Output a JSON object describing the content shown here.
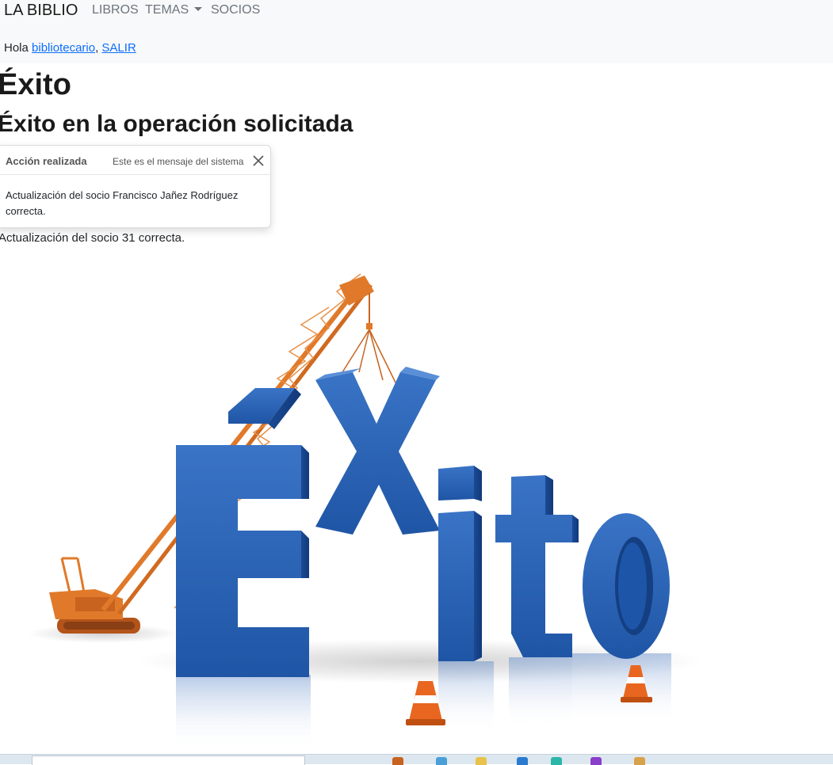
{
  "navbar": {
    "brand": "LA BIBLIO",
    "items": [
      {
        "label": "LIBROS"
      },
      {
        "label": "TEMAS"
      },
      {
        "label": "SOCIOS"
      }
    ]
  },
  "user_bar": {
    "greeting": "Hola ",
    "username": "bibliotecario",
    "separator": ", ",
    "logout": "SALIR"
  },
  "page": {
    "title": "Éxito",
    "subtitle": "Éxito en la operación solicitada",
    "message": "Actualización del socio 31 correcta."
  },
  "toast": {
    "title": "Acción realizada",
    "subtitle": "Este es el mensaje del sistema",
    "body": "Actualización del socio Francisco Jañez Rodríguez correcta.",
    "close_icon": "close-icon"
  },
  "illustration": {
    "text": "Éxito",
    "letter_color": "#2a63b5",
    "crane_color": "#e07a2a",
    "cone_color": "#e8661f"
  },
  "colors": {
    "navbar_bg": "#f8f9fa",
    "link": "#0d6efd",
    "nav_text": "#6c757d"
  }
}
